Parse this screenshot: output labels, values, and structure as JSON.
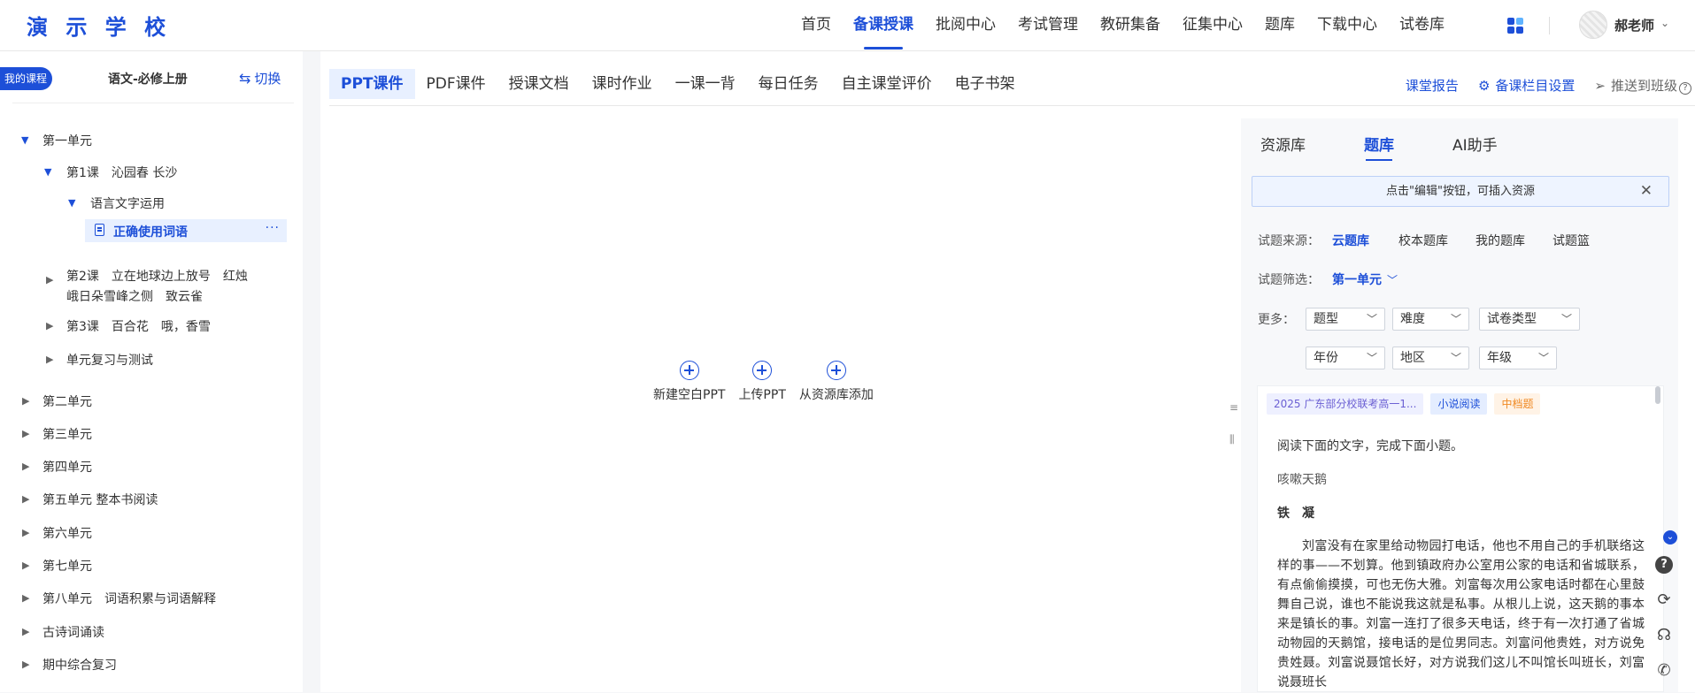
{
  "app": {
    "logo": "演 示 学 校"
  },
  "nav": {
    "items": [
      "首页",
      "备课授课",
      "批阅中心",
      "考试管理",
      "教研集备",
      "征集中心",
      "题库",
      "下载中心",
      "试卷库"
    ],
    "active_index": 1
  },
  "user": {
    "name": "郝老师",
    "caret": "⌄"
  },
  "sidebar": {
    "my_course": "我的课程",
    "course": "语文-必修上册",
    "switch_label": "切换",
    "switch_icon": "⇆",
    "tree": {
      "unit1": "第一单元",
      "lesson1": "第1课　沁园春 长沙",
      "section1": "语言文字运用",
      "active_item": "正确使用词语",
      "more_icon": "···",
      "lesson2_line1": "第2课　立在地球边上放号　红烛",
      "lesson2_line2": "峨日朵雪峰之侧　致云雀",
      "lesson3": "第3课　百合花　哦，香雪",
      "review": "单元复习与测试",
      "units": [
        "第二单元",
        "第三单元",
        "第四单元",
        "第五单元 整本书阅读",
        "第六单元",
        "第七单元",
        "第八单元　词语积累与词语解释",
        "古诗词诵读",
        "期中综合复习"
      ]
    }
  },
  "main": {
    "tabs": [
      "PPT课件",
      "PDF课件",
      "授课文档",
      "课时作业",
      "一课一背",
      "每日任务",
      "自主课堂评价",
      "电子书架"
    ],
    "active_tab": 0,
    "links": {
      "report": "课堂报告",
      "settings": "备课栏目设置",
      "push": "推送到班级",
      "settings_icon": "⚙",
      "push_icon": "➢",
      "help_icon": "?"
    },
    "actions": [
      "新建空白PPT",
      "上传PPT",
      "从资源库添加"
    ]
  },
  "mini_tools": {
    "a": "≡",
    "b": "⫼"
  },
  "panel": {
    "tabs": [
      "资源库",
      "题库",
      "AI助手"
    ],
    "active_tab": 1,
    "notice": "点击\"编辑\"按钮，可插入资源",
    "close_icon": "✕",
    "source_label": "试题来源：",
    "sources": [
      "云题库",
      "校本题库",
      "我的题库",
      "试题篮"
    ],
    "filter_label": "试题筛选：",
    "filter_value": "第一单元",
    "more_label": "更多：",
    "selects": [
      "题型",
      "难度",
      "试卷类型",
      "年份",
      "地区",
      "年级"
    ],
    "chevron": "﹀",
    "question": {
      "tags": [
        "2025 广东部分校联考高一1...",
        "小说阅读",
        "中档题"
      ],
      "instruction": "阅读下面的文字，完成下面小题。",
      "source_text": "咳嗽天鹅",
      "title": "铁　凝",
      "body": "刘富没有在家里给动物园打电话，他也不用自己的手机联络这样的事——不划算。他到镇政府办公室用公家的电话和省城联系，有点偷偷摸摸，可也无伤大雅。刘富每次用公家电话时都在心里鼓舞自己说，谁也不能说我这就是私事。从根儿上说，这天鹅的事本来是镇长的事。刘富一连打了很多天电话，终于有一次打通了省城动物园的天鹅馆，接电话的是位男同志。刘富问他贵姓，对方说免贵姓聂。刘富说聂馆长好，对方说我们这儿不叫馆长叫班长，刘富说聂班长"
    }
  },
  "float_tools": {
    "top": "⌄",
    "help": "?",
    "refresh": "⟳",
    "service": "☊",
    "phone": "✆"
  },
  "colors": {
    "accent": "#1d4fd8",
    "tag_purple": "#6b5fd3",
    "tag_orange": "#f08a24"
  }
}
